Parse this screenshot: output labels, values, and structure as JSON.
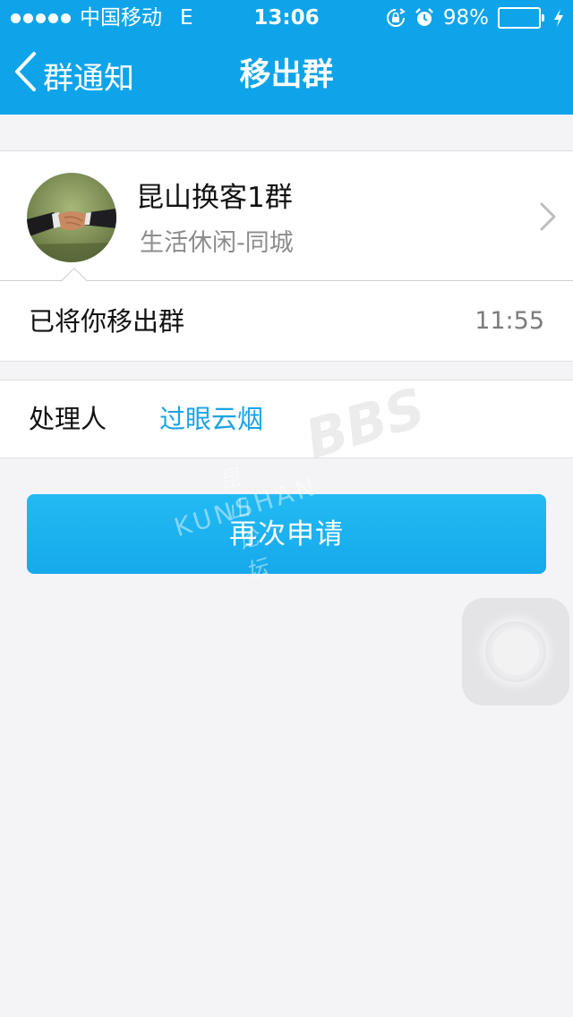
{
  "status_bar": {
    "carrier": "中国移动",
    "network": "E",
    "time": "13:06",
    "battery_text": "98%",
    "battery_level": 0.98,
    "signal_bars": 5
  },
  "nav": {
    "back_label": "群通知",
    "title": "移出群"
  },
  "group": {
    "name": "昆山换客1群",
    "category": "生活休闲-同城",
    "avatar_icon": "handshake-photo"
  },
  "message": {
    "text": "已将你移出群",
    "time": "11:55"
  },
  "handler": {
    "label": "处理人",
    "name": "过眼云烟"
  },
  "actions": {
    "reapply_label": "再次申请"
  },
  "watermark": {
    "cn": "昆山论坛",
    "en": "KUNSHAN",
    "bbs": "BBS"
  },
  "colors": {
    "header": "#0fa4ea",
    "button": "#1cb4f0",
    "link": "#1ba3e4",
    "background": "#f4f4f6",
    "battery": "#4cd964"
  }
}
